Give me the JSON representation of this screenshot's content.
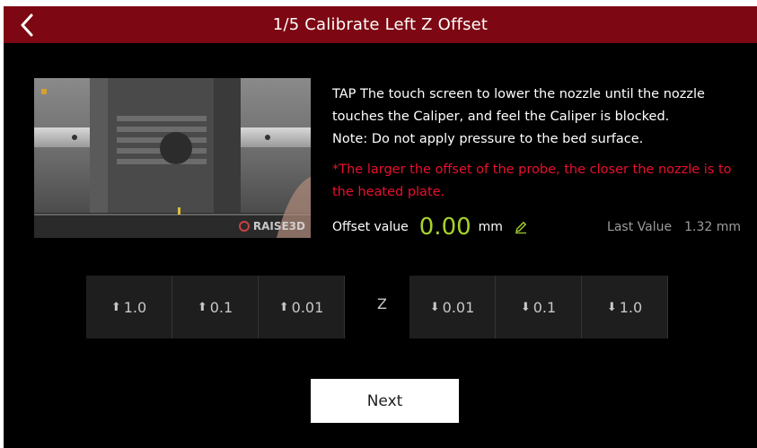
{
  "header": {
    "title": "1/5 Calibrate Left Z Offset",
    "back_icon": "chevron-left-icon"
  },
  "preview": {
    "brand_text": "RAISE3D"
  },
  "instructions": {
    "line1": "TAP The touch screen to lower the nozzle until the nozzle touches the Caliper, and feel the Caliper is blocked.",
    "line2": "Note: Do not apply pressure to the bed surface.",
    "warning": "*The larger the offset of the probe, the closer the nozzle is to the heated plate."
  },
  "offset": {
    "label": "Offset value",
    "value": "0.00",
    "unit": "mm",
    "edit_icon": "pencil-icon",
    "last_label": "Last Value",
    "last_value": "1.32 mm"
  },
  "steps": {
    "up": [
      {
        "label": "1.0",
        "icon": "arrow-up-icon"
      },
      {
        "label": "0.1",
        "icon": "arrow-up-icon"
      },
      {
        "label": "0.01",
        "icon": "arrow-up-icon"
      }
    ],
    "axis": "Z",
    "down": [
      {
        "label": "0.01",
        "icon": "arrow-down-icon"
      },
      {
        "label": "0.1",
        "icon": "arrow-down-icon"
      },
      {
        "label": "1.0",
        "icon": "arrow-down-icon"
      }
    ]
  },
  "footer": {
    "next_label": "Next"
  },
  "colors": {
    "header_bg": "#7d0712",
    "accent_green": "#a6d32c",
    "warning_red": "#e8102e"
  }
}
